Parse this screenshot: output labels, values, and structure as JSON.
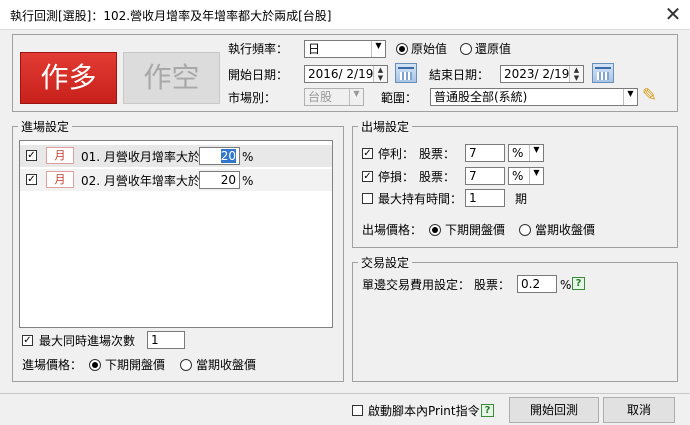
{
  "window": {
    "title": "執行回測[選股]：102.營收月增率及年增率都大於兩成[台股]",
    "close_glyph": "✕"
  },
  "mode": {
    "long_label": "作多",
    "short_label": "作空"
  },
  "settings": {
    "freq_label": "執行頻率：",
    "freq_value": "日",
    "price_original_label": "原始值",
    "price_restored_label": "還原值",
    "start_label": "開始日期：",
    "start_value": "2016/ 2/19",
    "end_label": "結束日期：",
    "end_value": "2023/ 2/19",
    "market_label": "市場別：",
    "market_value": "台股",
    "scope_label": "範圍：",
    "scope_value": "普通股全部(系統)"
  },
  "entry": {
    "group_label": "進場設定",
    "conditions": [
      {
        "checked": "✓",
        "period": "月",
        "text": "01. 月營收月增率大於",
        "value": "20",
        "unit": "%"
      },
      {
        "checked": "✓",
        "period": "月",
        "text": "02. 月營收年增率大於",
        "value": "20",
        "unit": "%"
      }
    ],
    "max_times_check": "✓",
    "max_times_label": "最大同時進場次數",
    "max_times_value": "1",
    "price_label": "進場價格：",
    "price_next_open": "下期開盤價",
    "price_close": "當期收盤價"
  },
  "exit": {
    "group_label": "出場設定",
    "take_profit_check": "✓",
    "take_profit_label": "停利：",
    "take_profit_stock_label": "股票：",
    "take_profit_value": "7",
    "take_profit_unit": "%",
    "stop_loss_check": "✓",
    "stop_loss_label": "停損：",
    "stop_loss_stock_label": "股票：",
    "stop_loss_value": "7",
    "stop_loss_unit": "%",
    "max_hold_label": "最大持有時間：",
    "max_hold_value": "1",
    "max_hold_unit": "期",
    "price_label": "出場價格：",
    "price_next_open": "下期開盤價",
    "price_close": "當期收盤價"
  },
  "trade": {
    "group_label": "交易設定",
    "fee_label": "單邊交易費用設定：",
    "fee_stock_label": "股票：",
    "fee_value": "0.2",
    "fee_unit": "%",
    "help_glyph": "?"
  },
  "footer": {
    "print_label": "啟動腳本內Print指令",
    "help_glyph": "?",
    "start_button": "開始回測",
    "cancel_button": "取消"
  },
  "icons": {
    "dropdown": "▼",
    "spin_up": "▲",
    "spin_down": "▼",
    "pencil": "✎"
  }
}
